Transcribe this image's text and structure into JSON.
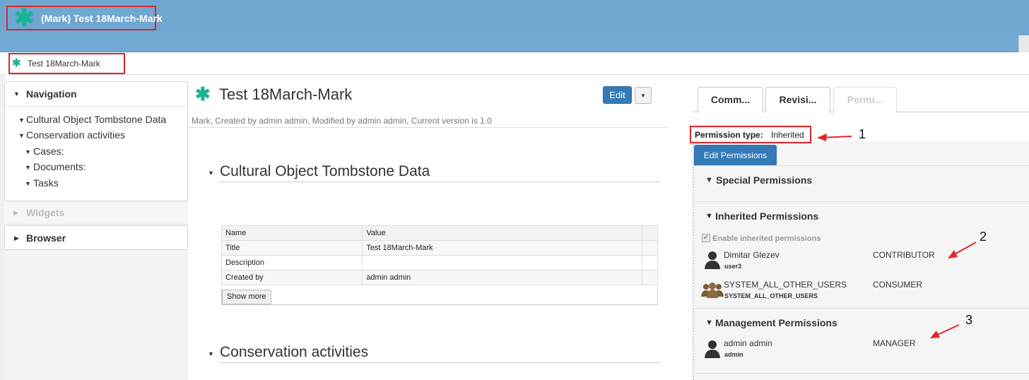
{
  "app_bar": {
    "title": "(Mark) Test 18March-Mark"
  },
  "breadcrumb": {
    "label": "Test 18March-Mark"
  },
  "left_panel": {
    "navigation": {
      "title": "Navigation",
      "items": [
        {
          "label": "Cultural Object Tombstone Data"
        },
        {
          "label": "Conservation activities"
        },
        {
          "label": "Cases:"
        },
        {
          "label": "Documents:"
        },
        {
          "label": "Tasks"
        }
      ]
    },
    "widgets": {
      "title": "Widgets"
    },
    "browser": {
      "title": "Browser"
    }
  },
  "main": {
    "title": "Test 18March-Mark",
    "edit_label": "Edit",
    "meta": "Mark, Created by admin admin, Modified by admin admin, Current version is 1.0",
    "sections": [
      {
        "title": "Cultural Object Tombstone Data"
      },
      {
        "title": "Conservation activities"
      }
    ],
    "grid": {
      "headers": [
        "Name",
        "Value"
      ],
      "rows": [
        [
          "Title",
          "Test 18March-Mark"
        ],
        [
          "Description",
          ""
        ],
        [
          "Created by",
          "admin admin"
        ]
      ],
      "show_more": "Show more"
    }
  },
  "tabs": [
    {
      "label": "Comm..."
    },
    {
      "label": "Revisi..."
    },
    {
      "label": "Permi..."
    }
  ],
  "permissions": {
    "type_label": "Permission type:",
    "type_value": "Inherited",
    "edit_button": "Edit Permissions",
    "special_title": "Special Permissions",
    "inherited_title": "Inherited Permissions",
    "enable_inherited": "Enable inherited permissions",
    "inherited_entries": [
      {
        "name": "Dimitar Glezev",
        "sub": "user3",
        "role": "CONTRIBUTOR"
      },
      {
        "name": "SYSTEM_ALL_OTHER_USERS",
        "sub": "SYSTEM_ALL_OTHER_USERS",
        "role": "CONSUMER"
      }
    ],
    "management_title": "Management Permissions",
    "management_entries": [
      {
        "name": "admin admin",
        "sub": "admin",
        "role": "MANAGER"
      }
    ]
  },
  "annotations": [
    "1",
    "2",
    "3"
  ],
  "colors": {
    "app_bar": "#6fa7d1",
    "accent_green": "#1ab394",
    "primary_button": "#337ab7",
    "annotation_red": "#d9262b"
  }
}
